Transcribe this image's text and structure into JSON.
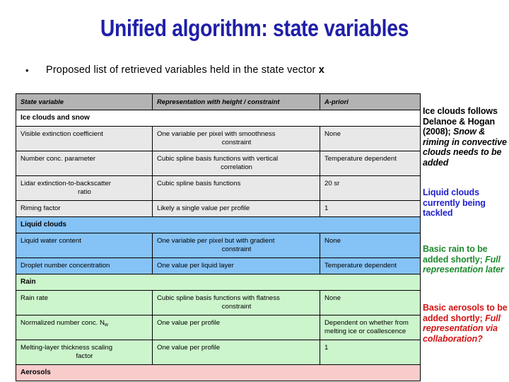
{
  "slide": {
    "title": "Unified algorithm: state variables",
    "bullet": {
      "marker": "•",
      "text_before": "Proposed list of retrieved variables held in the state vector ",
      "text_emphasis": "x"
    }
  },
  "table": {
    "headers": {
      "state_variable": "State variable",
      "representation": "Representation with height / constraint",
      "a_priori": "A-priori"
    },
    "sections": [
      {
        "id": "ice",
        "label": "Ice clouds and snow",
        "rows": [
          {
            "state_variable": "Visible extinction coefficient",
            "representation_line1": "One variable per pixel with smoothness",
            "representation_line2": "constraint",
            "a_priori": "None"
          },
          {
            "state_variable": "Number conc. parameter",
            "representation_line1": "Cubic spline basis functions with vertical",
            "representation_line2": "correlation",
            "a_priori": "Temperature dependent"
          },
          {
            "state_variable_line1": "Lidar extinction-to-backscatter",
            "state_variable_line2": "ratio",
            "representation_line1": "Cubic spline basis functions",
            "representation_line2": "",
            "a_priori": "20 sr"
          },
          {
            "state_variable": "Riming factor",
            "representation_line1": "Likely a single value per profile",
            "representation_line2": "",
            "a_priori": "1"
          }
        ]
      },
      {
        "id": "liquid",
        "label": "Liquid clouds",
        "rows": [
          {
            "state_variable": "Liquid water content",
            "representation_line1": "One variable per pixel but with gradient",
            "representation_line2": "constraint",
            "a_priori": "None"
          },
          {
            "state_variable": "Droplet number concentration",
            "representation_line1": "One value per liquid layer",
            "representation_line2": "",
            "a_priori": "Temperature dependent"
          }
        ]
      },
      {
        "id": "rain",
        "label": "Rain",
        "rows": [
          {
            "state_variable": "Rain rate",
            "representation_line1": "Cubic spline basis functions with flatness",
            "representation_line2": "constraint",
            "a_priori": "None"
          },
          {
            "state_variable_pre": "Normalized number conc. N",
            "state_variable_sub": "w",
            "representation_line1": "One value per profile",
            "representation_line2": "",
            "a_priori": "Dependent on whether from melting ice or coallescence"
          },
          {
            "state_variable_line1": "Melting-layer thickness scaling",
            "state_variable_line2": "factor",
            "representation_line1": "One value per profile",
            "representation_line2": "",
            "a_priori": "1"
          }
        ]
      },
      {
        "id": "aerosols",
        "label": "Aerosols",
        "rows": []
      }
    ]
  },
  "notes": {
    "ice": {
      "plain": "Ice clouds follows Delanoe & Hogan (2008); ",
      "italic": "Snow & riming in convective clouds needs to be added"
    },
    "liquid": {
      "bold": "Liquid clouds currently being tackled"
    },
    "rain": {
      "plain": "Basic rain to be added shortly; ",
      "italic": "Full representation later"
    },
    "aerosols": {
      "plain": "Basic aerosols to be added shortly; ",
      "italic": "Full representation via collaboration?"
    }
  },
  "colors": {
    "title": "#1f1fa8",
    "header_row": "#b3b3b3",
    "ice_rows": "#e8e8e8",
    "liquid_rows": "#85c2f5",
    "rain_rows": "#ccf5cc",
    "aerosol_rows": "#f9cccc",
    "note_ice": "#000000",
    "note_liquid": "#1f1fcc",
    "note_rain": "#1d8a2e",
    "note_aerosols": "#d41313"
  }
}
